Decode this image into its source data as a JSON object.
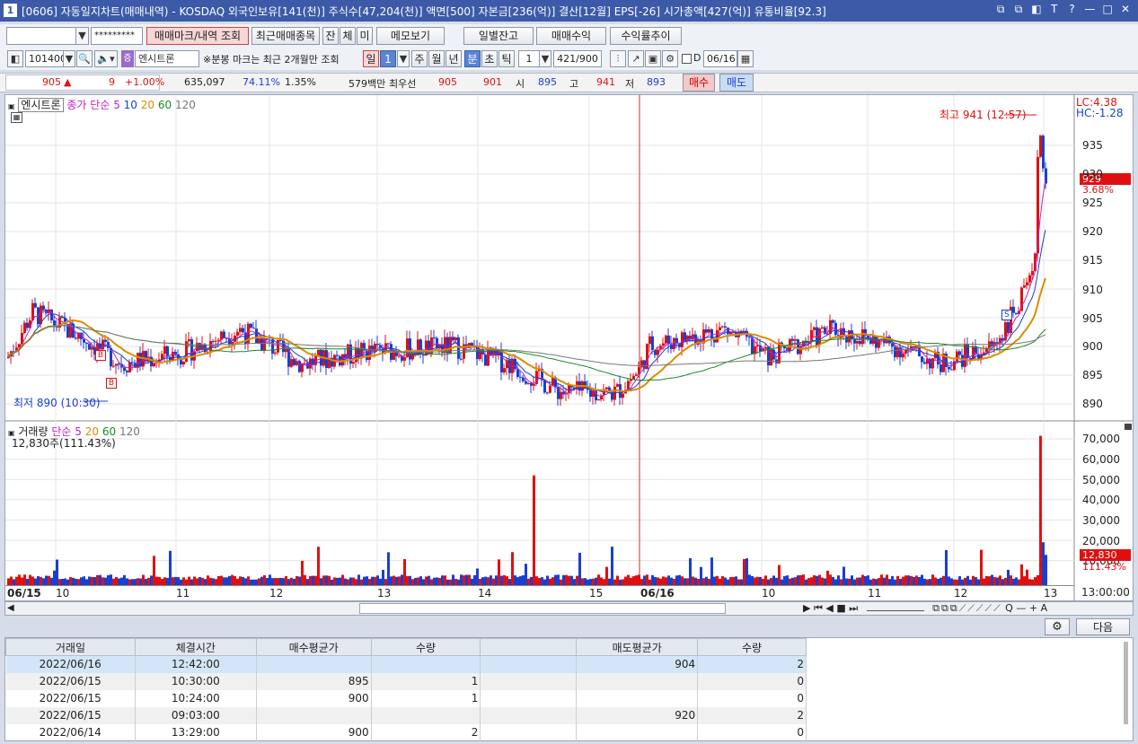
{
  "window": {
    "icon": "1",
    "title": "[0606] 자동일지차트(매매내역) - KOSDAQ 외국인보유[141(천)] 주식수[47,204(천)] 액면[500] 자본금[236(억)] 결산[12월] EPS[-26] 시가총액[427(억)] 유통비율[92.3]",
    "controls": [
      "⧉",
      "⧉",
      "◧",
      "T",
      "?",
      "—",
      "□",
      "✕"
    ]
  },
  "toolbar1": {
    "account_value": "",
    "password_mask": "*********",
    "buttons": [
      "매매마크/내역 조회",
      "최근매매종목",
      "잔",
      "체",
      "미",
      "메모보기",
      "일별잔고",
      "매매수익",
      "수익률추이"
    ]
  },
  "toolbar2": {
    "code": "101400",
    "badge": "증",
    "stock_name": "엔시트론",
    "note": "※분봉 마크는 최근 2개월만 조회",
    "periods": [
      "일",
      "1",
      "주",
      "월",
      "년",
      "분",
      "초",
      "틱"
    ],
    "unit": "1",
    "count": "421/900",
    "date_checkbox_label": "D",
    "date": "06/16"
  },
  "quote": {
    "price": "905",
    "arrow": "▲",
    "change": "9",
    "change_pct": "+1.00%",
    "volume": "635,097",
    "volume_ratio": "74.11%",
    "turnover": "1.35%",
    "amount": "579백만",
    "best_label": "최우선",
    "ask": "905",
    "bid": "901",
    "open_label": "시",
    "open": "895",
    "high_label": "고",
    "high": "941",
    "low_label": "저",
    "low": "893",
    "buy_label": "매수",
    "sell_label": "매도"
  },
  "price_panel": {
    "name_tag": "엔시트론",
    "ma_label": "종가 단순",
    "ma_periods": [
      "5",
      "10",
      "20",
      "60",
      "120"
    ],
    "lc": "LC:4.38",
    "hc": "HC:-1.28",
    "high_marker": "최고 941 (12:57)",
    "low_marker": "최저 890 (10:30)",
    "current_price": "929",
    "current_pct": "3.68%",
    "y_ticks": [
      "935",
      "930",
      "925",
      "920",
      "915",
      "910",
      "905",
      "900",
      "895",
      "890"
    ],
    "trade_marks": [
      "B",
      "B",
      "S"
    ]
  },
  "volume_panel": {
    "name_tag": "거래량",
    "ma_label": "단순",
    "ma_periods": [
      "5",
      "20",
      "60",
      "120"
    ],
    "current_text": "12,830주(111.43%)",
    "current_value": "12,830",
    "current_pct": "111.43%",
    "y_ticks": [
      "70,000",
      "60,000",
      "50,000",
      "40,000",
      "30,000",
      "20,000",
      "10,000"
    ]
  },
  "x_axis": [
    "06/15",
    "10",
    "11",
    "12",
    "13",
    "14",
    "15",
    "06/16",
    "10",
    "11",
    "12",
    "13"
  ],
  "x_axis_end": "13:00:00",
  "scroll_icons": [
    "▶",
    "⏮",
    "◀",
    "■",
    "⏭",
    "Q",
    "—",
    "+",
    "A"
  ],
  "settings_icon": "⚙",
  "next_button": "다음",
  "trades": {
    "headers": [
      "거래일",
      "체결시간",
      "매수평균가",
      "수량",
      "",
      "매도평균가",
      "수량"
    ],
    "rows": [
      [
        "2022/06/16",
        "12:42:00",
        "",
        "",
        "",
        "904",
        "2"
      ],
      [
        "2022/06/15",
        "10:30:00",
        "895",
        "1",
        "",
        "",
        "0"
      ],
      [
        "2022/06/15",
        "10:24:00",
        "900",
        "1",
        "",
        "",
        "0"
      ],
      [
        "2022/06/15",
        "09:03:00",
        "",
        "",
        "",
        "920",
        "2"
      ],
      [
        "2022/06/14",
        "13:29:00",
        "900",
        "2",
        "",
        "",
        "0"
      ]
    ]
  },
  "colors": {
    "up": "#e01010",
    "down": "#1a3fd0",
    "ma5": "#c020c0",
    "ma10": "#1a3fd0",
    "ma20": "#e08a00",
    "ma60": "#1a8a2a",
    "ma120": "#777777"
  }
}
